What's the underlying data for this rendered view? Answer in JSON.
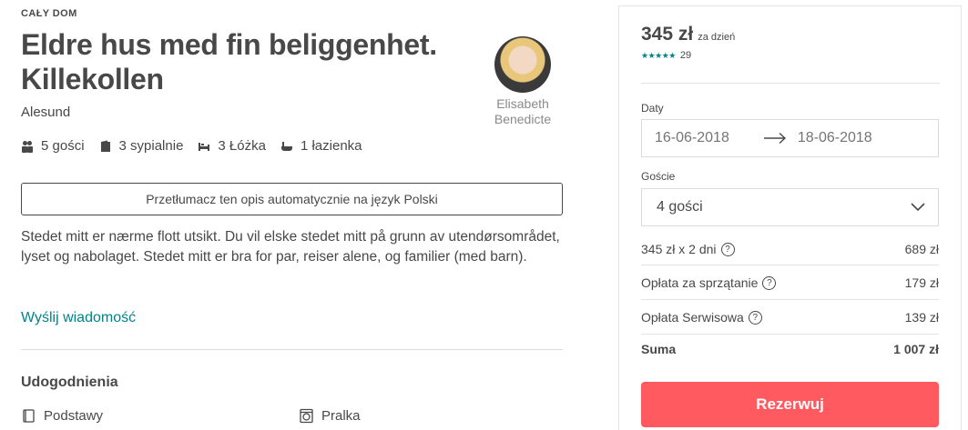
{
  "listing": {
    "kicker": "CAŁY DOM",
    "title": "Eldre hus med fin beliggenhet. Killekollen",
    "location": "Alesund",
    "host_name": "Elisabeth Benedicte",
    "facts": {
      "guests": "5 gości",
      "bedrooms": "3 sypialnie",
      "beds": "3 Łóżka",
      "baths": "1 łazienka"
    },
    "translate_label": "Przetłumacz ten opis automatycznie na język Polski",
    "description": "Stedet mitt er nærme flott utsikt. Du vil elske stedet mitt på grunn av utendørsområdet, lyset og nabolaget. Stedet mitt er bra for par, reiser alene, og familier (med barn).",
    "send_message": "Wyślij wiadomość",
    "amenities_title": "Udogodnienia",
    "amenities": [
      "Podstawy",
      "Pralka"
    ]
  },
  "booking": {
    "price": "345 zł",
    "per": "za dzień",
    "rating_stars": 4.5,
    "review_count": "29",
    "dates_label": "Daty",
    "check_in": "16-06-2018",
    "check_out": "18-06-2018",
    "guests_label": "Goście",
    "guests_value": "4 gości",
    "lines": [
      {
        "label": "345 zł x 2 dni",
        "amount": "689 zł",
        "help": true
      },
      {
        "label": "Opłata za sprzątanie",
        "amount": "179 zł",
        "help": true
      },
      {
        "label": "Opłata Serwisowa",
        "amount": "139 zł",
        "help": true
      }
    ],
    "total_label": "Suma",
    "total_amount": "1 007 zł",
    "reserve_label": "Rezerwuj",
    "colors": {
      "accent": "#ff5a5f",
      "teal": "#008489",
      "text": "#484848"
    }
  }
}
